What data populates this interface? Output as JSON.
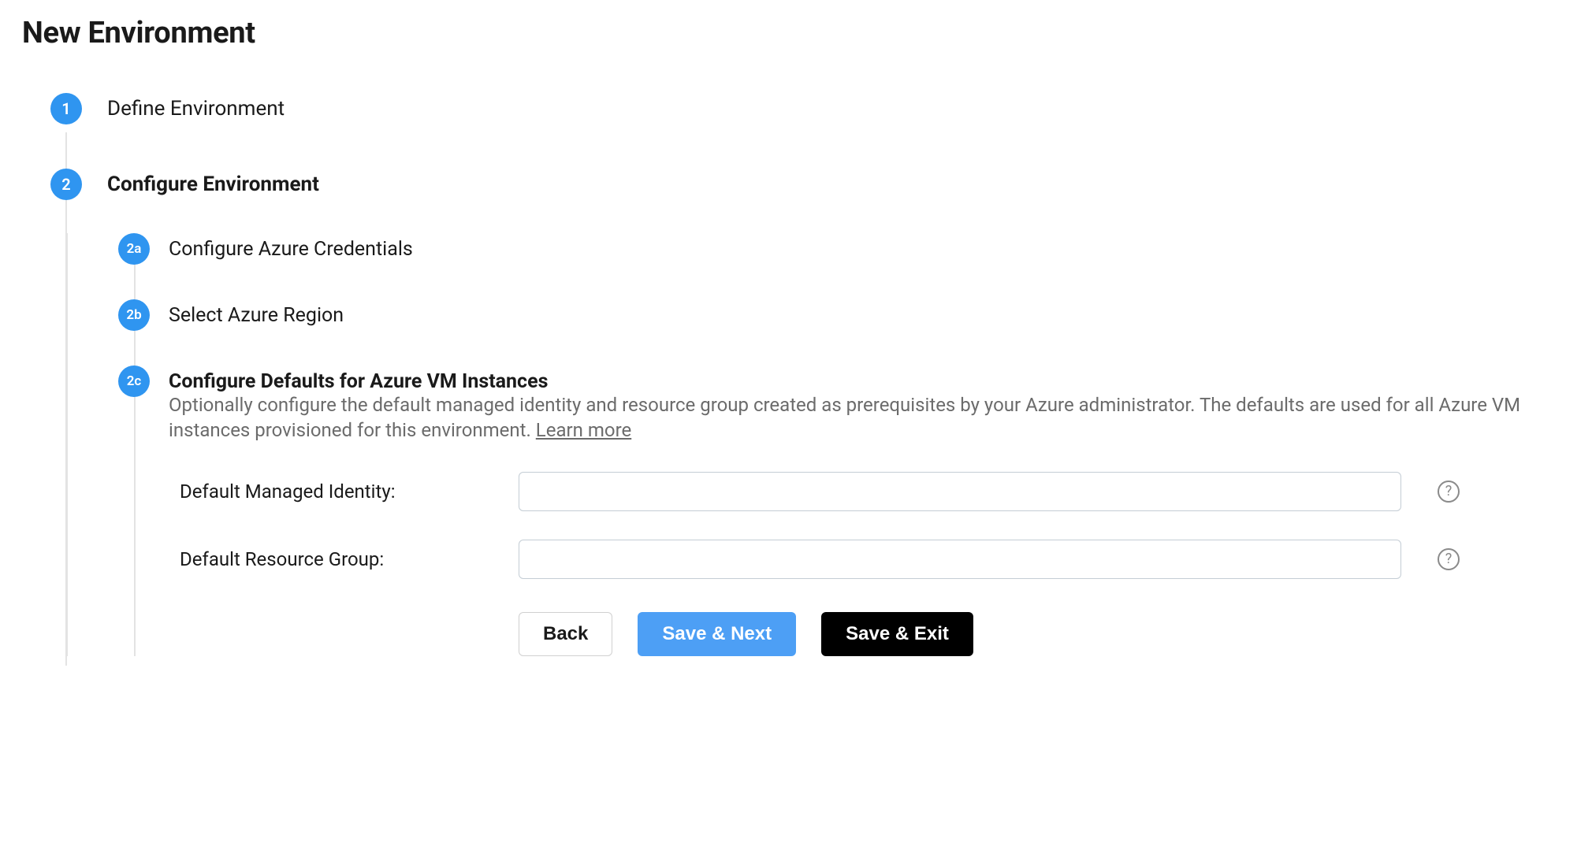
{
  "page_title": "New Environment",
  "steps": [
    {
      "badge": "1",
      "label": "Define Environment",
      "active": false
    },
    {
      "badge": "2",
      "label": "Configure Environment",
      "active": true
    }
  ],
  "substeps": [
    {
      "badge": "2a",
      "label": "Configure Azure Credentials",
      "active": false
    },
    {
      "badge": "2b",
      "label": "Select Azure Region",
      "active": false
    },
    {
      "badge": "2c",
      "label": "Configure Defaults for Azure VM Instances",
      "active": true
    }
  ],
  "substep_2c": {
    "description_pre": "Optionally configure the default managed identity and resource group created as prerequisites by your Azure administrator. The defaults are used for all Azure VM instances provisioned for this environment. ",
    "learn_more": "Learn more",
    "fields": {
      "managed_identity_label": "Default Managed Identity:",
      "managed_identity_value": "",
      "resource_group_label": "Default Resource Group:",
      "resource_group_value": ""
    }
  },
  "buttons": {
    "back": "Back",
    "save_next": "Save & Next",
    "save_exit": "Save & Exit"
  },
  "help_glyph": "?"
}
